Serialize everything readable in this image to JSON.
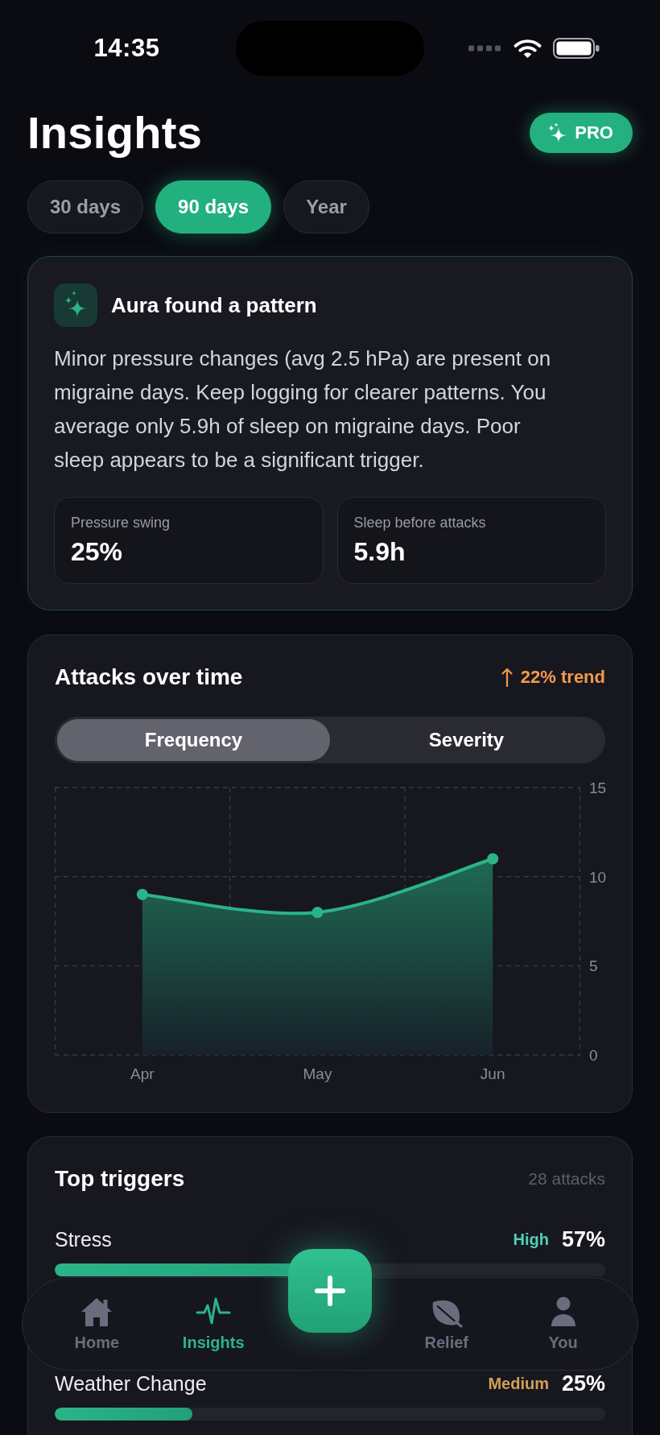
{
  "status_bar": {
    "time": "14:35"
  },
  "header": {
    "title": "Insights",
    "pro_button": "PRO"
  },
  "range_tabs": [
    {
      "label": "30 days",
      "selected": false
    },
    {
      "label": "90 days",
      "selected": true
    },
    {
      "label": "Year",
      "selected": false
    }
  ],
  "insight_card": {
    "title": "Aura found a pattern",
    "body": "Minor pressure changes (avg 2.5 hPa) are present on migraine days. Keep logging for clearer patterns. You average only 5.9h of sleep on migraine days. Poor sleep appears to be a significant trigger.",
    "stats": [
      {
        "label": "Pressure swing",
        "value": "25%"
      },
      {
        "label": "Sleep before attacks",
        "value": "5.9h"
      }
    ]
  },
  "attacks_card": {
    "title": "Attacks over time",
    "trend": "22% trend",
    "segments": [
      {
        "label": "Frequency",
        "selected": true
      },
      {
        "label": "Severity",
        "selected": false
      }
    ],
    "chart_data": {
      "type": "area",
      "categories": [
        "Apr",
        "May",
        "Jun"
      ],
      "values": [
        9,
        8,
        11
      ],
      "ylim": [
        0,
        15
      ],
      "yticks": [
        0,
        5,
        10,
        15
      ]
    }
  },
  "triggers_card": {
    "title": "Top triggers",
    "count": "28 attacks",
    "items": [
      {
        "name": "Stress",
        "severity": "High",
        "color": "#4fd1b3",
        "percent": "57%",
        "level": 0.57
      },
      {
        "name": "Weather Change",
        "severity": "Medium",
        "color": "#d1a055",
        "percent": "25%",
        "level": 0.25
      }
    ]
  },
  "tab_bar": {
    "items": [
      {
        "label": "Home",
        "selected": false
      },
      {
        "label": "Insights",
        "selected": true
      },
      {
        "label": "Relief",
        "selected": false
      },
      {
        "label": "You",
        "selected": false
      }
    ]
  }
}
